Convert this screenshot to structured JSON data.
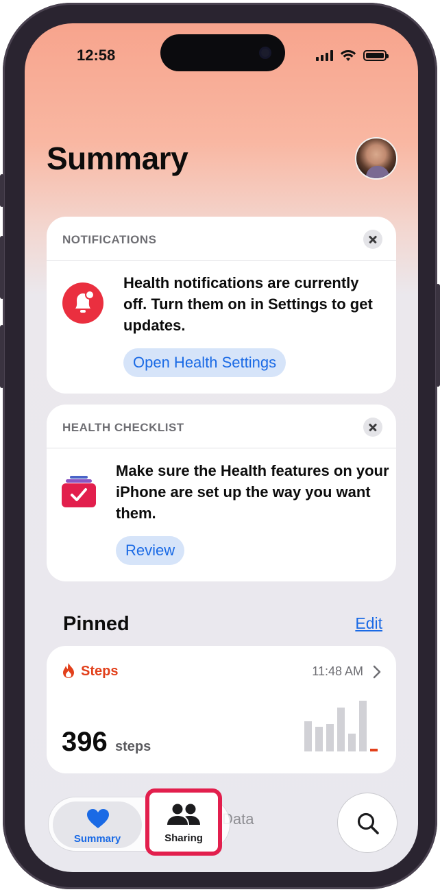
{
  "status_bar": {
    "time": "12:58"
  },
  "page": {
    "title": "Summary"
  },
  "notifications_card": {
    "label": "NOTIFICATIONS",
    "message": "Health notifications are currently off. Turn them on in Settings to get updates.",
    "button": "Open Health Settings"
  },
  "checklist_card": {
    "label": "HEALTH CHECKLIST",
    "message": "Make sure the Health features on your iPhone are set up the way you want them.",
    "button": "Review"
  },
  "pinned": {
    "heading": "Pinned",
    "edit": "Edit",
    "steps": {
      "label": "Steps",
      "time": "11:48 AM",
      "value": "396",
      "unit": "steps"
    }
  },
  "tab_bar": {
    "tabs": [
      {
        "label": "Summary"
      },
      {
        "label": "Sharing"
      }
    ],
    "hidden_tab_fragment": "Data"
  },
  "colors": {
    "accent_blue": "#1a6ae5",
    "steps_orange": "#e2401b",
    "highlight_red": "#e21f4d",
    "bell_red": "#ea2f3f"
  },
  "icons": [
    "bell-icon",
    "checklist-icon",
    "close-icon",
    "flame-icon",
    "chevron-right-icon",
    "heart-icon",
    "people-icon",
    "search-icon"
  ]
}
